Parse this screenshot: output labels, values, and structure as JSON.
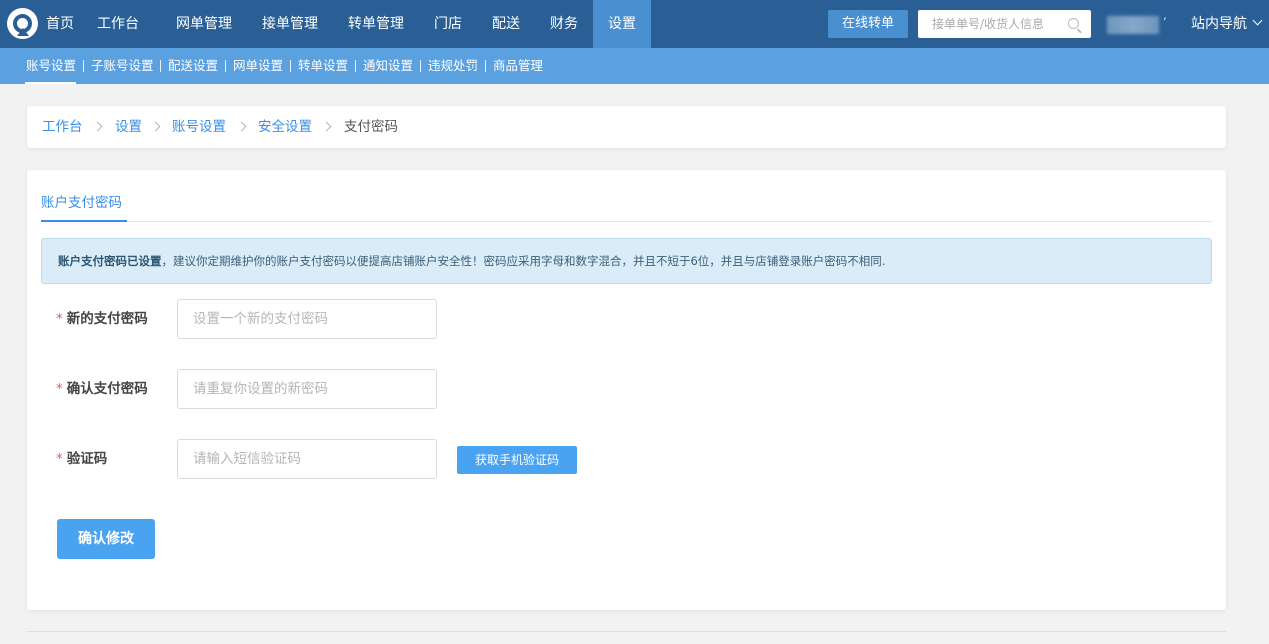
{
  "topnav": {
    "items": [
      {
        "label": "首页"
      },
      {
        "label": "工作台"
      },
      {
        "label": "网单管理"
      },
      {
        "label": "接单管理"
      },
      {
        "label": "转单管理"
      },
      {
        "label": "门店"
      },
      {
        "label": "配送"
      },
      {
        "label": "财务"
      },
      {
        "label": "设置",
        "active": true
      }
    ],
    "online_transfer_label": "在线转单",
    "search_placeholder": "接单单号/收货人信息",
    "site_nav_label": "站内导航"
  },
  "subnav": {
    "items": [
      {
        "label": "账号设置",
        "active": true
      },
      {
        "label": "子账号设置"
      },
      {
        "label": "配送设置"
      },
      {
        "label": "网单设置"
      },
      {
        "label": "转单设置"
      },
      {
        "label": "通知设置"
      },
      {
        "label": "违规处罚"
      },
      {
        "label": "商品管理"
      }
    ]
  },
  "breadcrumb": {
    "items": [
      "工作台",
      "设置",
      "账号设置",
      "安全设置",
      "支付密码"
    ]
  },
  "main": {
    "tab_label": "账户支付密码",
    "alert": {
      "strong": "账户支付密码已设置",
      "text": "，建议你定期维护你的账户支付密码以便提高店铺账户安全性！密码应采用字母和数字混合，并且不短于6位，并且与店铺登录账户密码不相同."
    },
    "form": {
      "required_mark": "*",
      "new_password": {
        "label": "新的支付密码",
        "placeholder": "设置一个新的支付密码",
        "value": ""
      },
      "confirm_password": {
        "label": "确认支付密码",
        "placeholder": "请重复你设置的新密码",
        "value": ""
      },
      "sms_code": {
        "label": "验证码",
        "placeholder": "请输入短信验证码",
        "value": ""
      },
      "get_code_label": "获取手机验证码",
      "submit_label": "确认修改"
    }
  },
  "colors": {
    "topnav_bg": "#2a5f96",
    "topnav_active": "#4a90d1",
    "subnav_bg": "#5ba0df",
    "link": "#3a8ee6",
    "primary_button": "#4aa3f0",
    "alert_bg": "#d9ecf8",
    "required": "#e55555"
  },
  "icons": {
    "logo": "logo-icon",
    "search": "search-icon",
    "site_nav": "chevron-down-icon",
    "breadcrumb_separator": "chevron-right-icon"
  }
}
